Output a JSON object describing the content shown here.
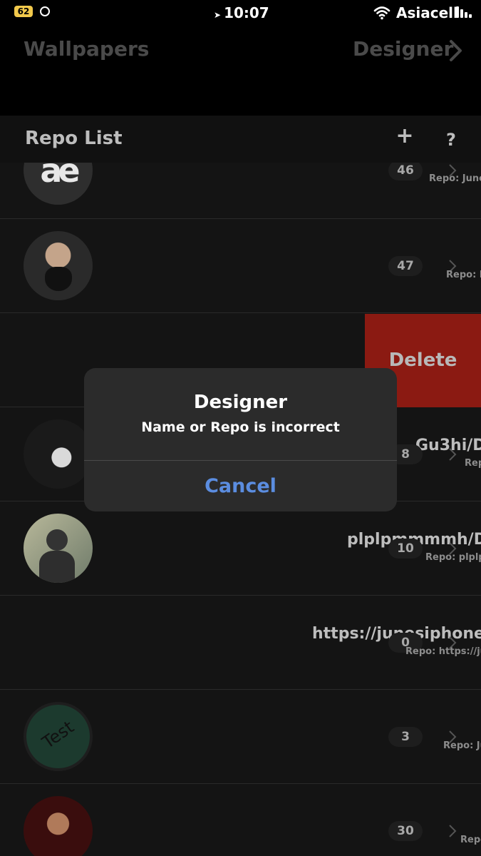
{
  "status": {
    "battery": "62",
    "time": "10:07",
    "carrier": "Asiacell"
  },
  "header": {
    "left_title": "Wallpapers",
    "right_title": "Designer"
  },
  "repo_bar": {
    "title": "Repo List",
    "add_label": "+",
    "help_label": "?"
  },
  "rows": [
    {
      "count": "46",
      "repo": "Repo: Junes",
      "name": ""
    },
    {
      "count": "47",
      "repo": "Repo: Er",
      "name": ""
    },
    {
      "count": "",
      "repo": "",
      "name": ""
    },
    {
      "count": "8",
      "repo": "Repo",
      "name": "Gu3hi/D"
    },
    {
      "count": "10",
      "repo": "Repo: plplpr",
      "name": "plplpmmmmh/D"
    },
    {
      "count": "0",
      "repo": "Repo: https://jur",
      "name": "https://junesiphone.c"
    },
    {
      "count": "3",
      "repo": "Repo: Ju",
      "name": ""
    },
    {
      "count": "30",
      "repo": "Repo",
      "name": ""
    }
  ],
  "avatar_text": {
    "logo": "ae",
    "test": "Test"
  },
  "swipe": {
    "delete_label": "Delete"
  },
  "dialog": {
    "title": "Designer",
    "message": "Name or Repo is incorrect",
    "cancel_label": "Cancel"
  },
  "colors": {
    "accent": "#5b8de0",
    "delete": "#8b1a12",
    "battery": "#f2c94c"
  }
}
